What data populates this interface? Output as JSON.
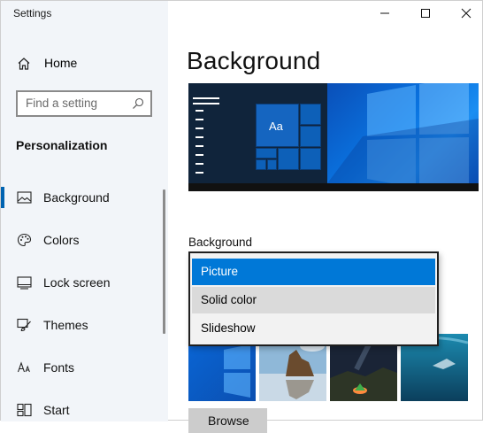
{
  "window": {
    "title": "Settings",
    "controls": [
      "minimize",
      "maximize",
      "close"
    ]
  },
  "sidebar": {
    "home_label": "Home",
    "search_placeholder": "Find a setting",
    "section_title": "Personalization",
    "items": [
      {
        "label": "Background",
        "icon": "picture-icon",
        "selected": true
      },
      {
        "label": "Colors",
        "icon": "palette-icon",
        "selected": false
      },
      {
        "label": "Lock screen",
        "icon": "lock-screen-icon",
        "selected": false
      },
      {
        "label": "Themes",
        "icon": "themes-brush-icon",
        "selected": false
      },
      {
        "label": "Fonts",
        "icon": "fonts-icon",
        "selected": false
      },
      {
        "label": "Start",
        "icon": "start-icon",
        "selected": false
      }
    ]
  },
  "main": {
    "page_title": "Background",
    "preview": {
      "sample_text": "Aa"
    },
    "background_label": "Background",
    "dropdown": {
      "selected": "Picture",
      "options": [
        "Picture",
        "Solid color",
        "Slideshow"
      ]
    },
    "browse_label": "Browse"
  },
  "colors": {
    "accent": "#0078d7",
    "sidebar_bg": "#f2f5f9",
    "selected_marker": "#0063b1"
  }
}
